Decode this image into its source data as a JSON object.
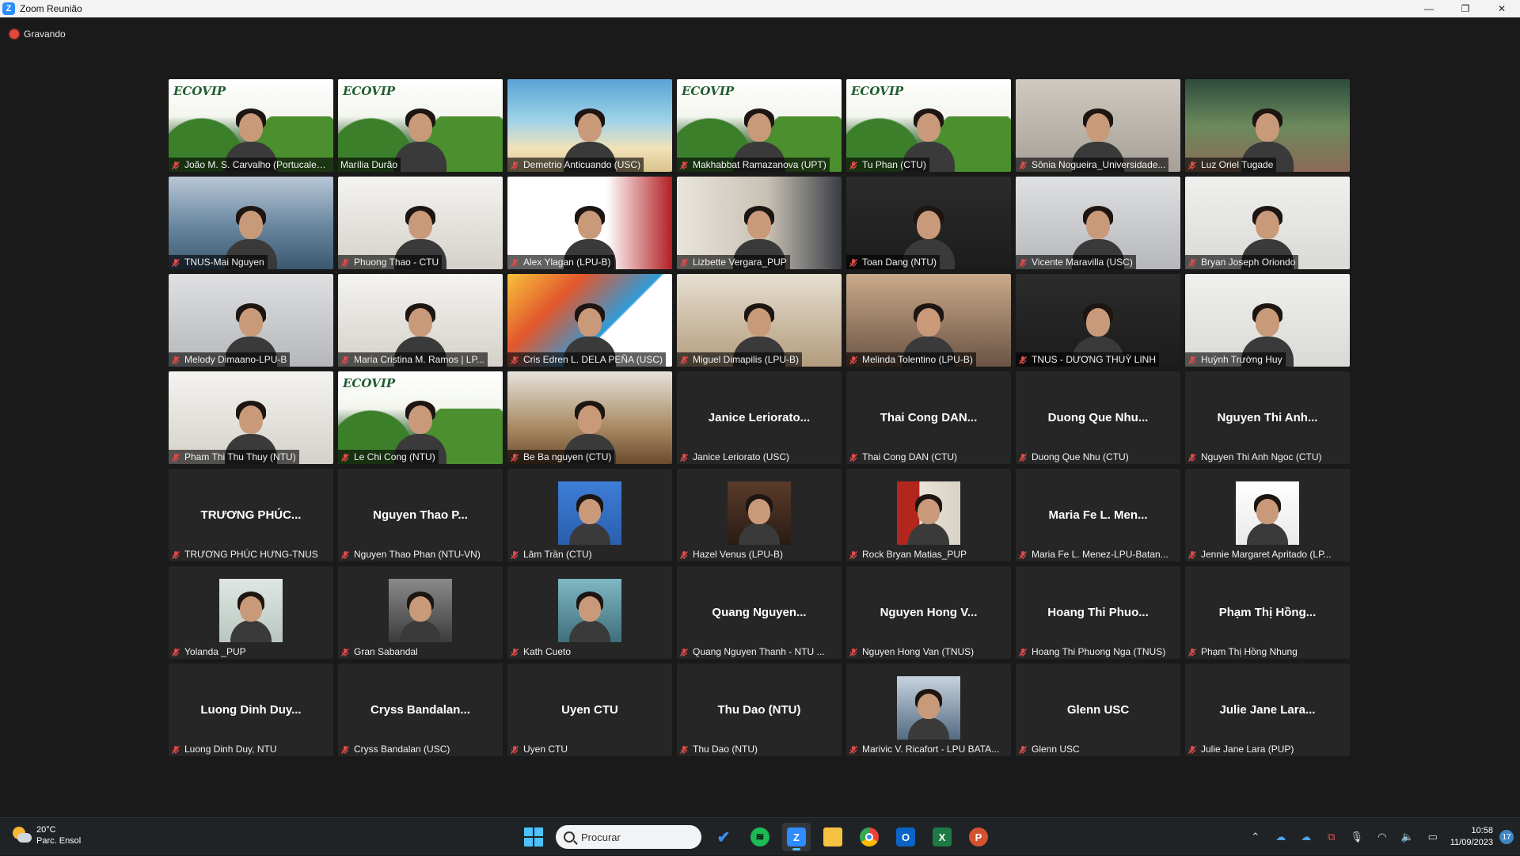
{
  "window": {
    "title": "Zoom Reunião",
    "minimize": "—",
    "maximize": "❐",
    "close": "✕"
  },
  "recording": {
    "label": "Gravando",
    "color": "#e2483d"
  },
  "participants": [
    {
      "name": "João M. S. Carvalho (Portucalens...",
      "bg": "ecovip",
      "video": true
    },
    {
      "name": "Marília Durão",
      "bg": "ecovip",
      "video": true,
      "active_speaker": true
    },
    {
      "name": "Demetrio Anticuando (USC)",
      "bg": "beach",
      "video": true
    },
    {
      "name": "Makhabbat Ramazanova (UPT)",
      "bg": "ecovip",
      "video": true
    },
    {
      "name": "Tu Phan (CTU)",
      "bg": "ecovip",
      "video": true
    },
    {
      "name": "Sônia Nogueira_Universidade...",
      "bg": "room",
      "video": true
    },
    {
      "name": "Luz Oriel Tugade",
      "bg": "plants",
      "video": true
    },
    {
      "name": "TNUS-Mai Nguyen",
      "bg": "sea",
      "video": true
    },
    {
      "name": "Phuong Thao - CTU",
      "bg": "office",
      "video": true
    },
    {
      "name": "Alex Ylagan (LPU-B)",
      "bg": "red",
      "video": true
    },
    {
      "name": "Lizbette Vergara_PUP",
      "bg": "shelf",
      "video": true
    },
    {
      "name": "Toan Dang (NTU)",
      "bg": "dark",
      "video": true
    },
    {
      "name": "Vicente Maravilla (USC)",
      "bg": "grey",
      "video": true
    },
    {
      "name": "Bryan Joseph Oriondo",
      "bg": "window",
      "video": true
    },
    {
      "name": "Melody Dimaano-LPU-B",
      "bg": "grey",
      "video": true
    },
    {
      "name": "Maria Cristina M. Ramos | LP...",
      "bg": "office",
      "video": true
    },
    {
      "name": "Cris Edren L. DELA PEÑA (USC)",
      "bg": "colorful",
      "video": true
    },
    {
      "name": "Miguel Dimapilis (LPU-B)",
      "bg": "kitchen",
      "video": true
    },
    {
      "name": "Melinda Tolentino (LPU-B)",
      "bg": "warm",
      "video": true
    },
    {
      "name": "TNUS - DƯƠNG THUỲ LINH",
      "bg": "dark",
      "video": true
    },
    {
      "name": "Huỳnh Trường Huy",
      "bg": "window",
      "video": true
    },
    {
      "name": "Pham Thi Thu Thuy (NTU)",
      "bg": "office",
      "video": true
    },
    {
      "name": "Le Chi Cong (NTU)",
      "bg": "ecovip",
      "video": true
    },
    {
      "name": "Be Ba nguyen (CTU)",
      "bg": "wood",
      "video": true
    },
    {
      "name": "Janice Leriorato (USC)",
      "display": "Janice  Leriorato...",
      "video": false
    },
    {
      "name": "Thai Cong DAN (CTU)",
      "display": "Thai Cong DAN...",
      "video": false
    },
    {
      "name": "Duong Que Nhu (CTU)",
      "display": "Duong Que Nhu...",
      "video": false
    },
    {
      "name": "Nguyen Thi Anh Ngoc (CTU)",
      "display": "Nguyen Thi Anh...",
      "video": false
    },
    {
      "name": "TRƯƠNG PHÚC HƯNG-TNUS",
      "display": "TRƯƠNG PHÚC...",
      "video": false
    },
    {
      "name": "Nguyen Thao Phan (NTU-VN)",
      "display": "Nguyen Thao P...",
      "video": false
    },
    {
      "name": "Lâm Trần (CTU)",
      "photo": "blue",
      "video": false
    },
    {
      "name": "Hazel Venus (LPU-B)",
      "photo": "dark",
      "video": false
    },
    {
      "name": "Rock Bryan Matias_PUP",
      "photo": "flag",
      "video": false
    },
    {
      "name": "Maria Fe L. Menez-LPU-Batan...",
      "display": "Maria Fe L. Men...",
      "video": false
    },
    {
      "name": "Jennie Margaret Apritado (LP...",
      "photo": "white",
      "video": false
    },
    {
      "name": "Yolanda _PUP",
      "photo": "light",
      "video": false
    },
    {
      "name": "Gran Sabandal",
      "photo": "bw",
      "video": false
    },
    {
      "name": "Kath Cueto",
      "photo": "teal",
      "video": false
    },
    {
      "name": "Quang Nguyen Thanh - NTU ...",
      "display": "Quang  Nguyen...",
      "video": false
    },
    {
      "name": "Nguyen Hong Van (TNUS)",
      "display": "Nguyen Hong V...",
      "video": false
    },
    {
      "name": "Hoang Thi Phuong Nga (TNUS)",
      "display": "Hoang Thi Phuo...",
      "video": false
    },
    {
      "name": "Phạm Thị Hồng Nhung",
      "display": "Phạm Thị Hồng...",
      "video": false
    },
    {
      "name": "Luong Dinh Duy, NTU",
      "display": "Luong Dinh Duy...",
      "video": false
    },
    {
      "name": "Cryss Bandalan (USC)",
      "display": "Cryss  Bandalan...",
      "video": false
    },
    {
      "name": "Uyen CTU",
      "display": "Uyen CTU",
      "video": false
    },
    {
      "name": "Thu Dao (NTU)",
      "display": "Thu Dao (NTU)",
      "video": false
    },
    {
      "name": "Marivic V. Ricafort - LPU BATA...",
      "photo": "pair",
      "video": false
    },
    {
      "name": "Glenn USC",
      "display": "Glenn USC",
      "video": false
    },
    {
      "name": "Julie Jane  Lara (PUP)",
      "display": "Julie Jane  Lara...",
      "video": false
    }
  ],
  "taskbar": {
    "weather_temp": "20°C",
    "weather_desc": "Parc. Ensol",
    "search_placeholder": "Procurar",
    "time": "10:58",
    "date": "11/09/2023",
    "notification_count": "17",
    "accent": "#4cc2ff"
  }
}
